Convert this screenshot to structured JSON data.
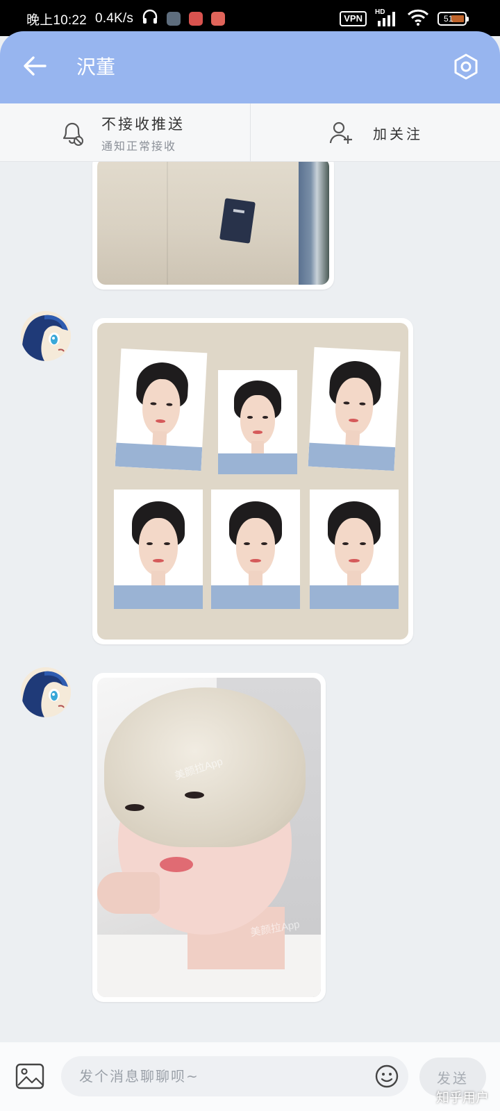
{
  "status_bar": {
    "time_text": "晚上10:22",
    "speed_text": "0.4K/s",
    "vpn_label": "VPN",
    "network_label": "HD",
    "battery_level": "51",
    "icons": [
      "headphones-icon",
      "app-notification-icon",
      "app-notification-icon",
      "app-notification-icon",
      "signal-icon",
      "wifi-icon",
      "battery-icon"
    ]
  },
  "header": {
    "title": "沢董",
    "back_icon": "arrow-left-icon",
    "settings_icon": "hexagon-settings-icon",
    "background_color": "#97b5ef"
  },
  "action_bar": {
    "mute": {
      "icon": "bell-off-icon",
      "title": "不接收推送",
      "subtitle": "通知正常接收"
    },
    "follow": {
      "icon": "add-user-icon",
      "label": "加关注"
    }
  },
  "messages": [
    {
      "type": "image",
      "description_icon": "photo",
      "partial": true
    },
    {
      "type": "image",
      "sender": "contact",
      "avatar_icon": "anime-avatar"
    },
    {
      "type": "image",
      "sender": "contact",
      "avatar_icon": "anime-avatar",
      "watermarks": [
        "美颜拉App",
        "美颜拉App"
      ]
    }
  ],
  "input_bar": {
    "image_icon": "image-icon",
    "placeholder": "发个消息聊聊呗~",
    "value": "",
    "emoji_icon": "smiley-icon",
    "send_label": "发送"
  },
  "platform_watermark": "知乎用户"
}
